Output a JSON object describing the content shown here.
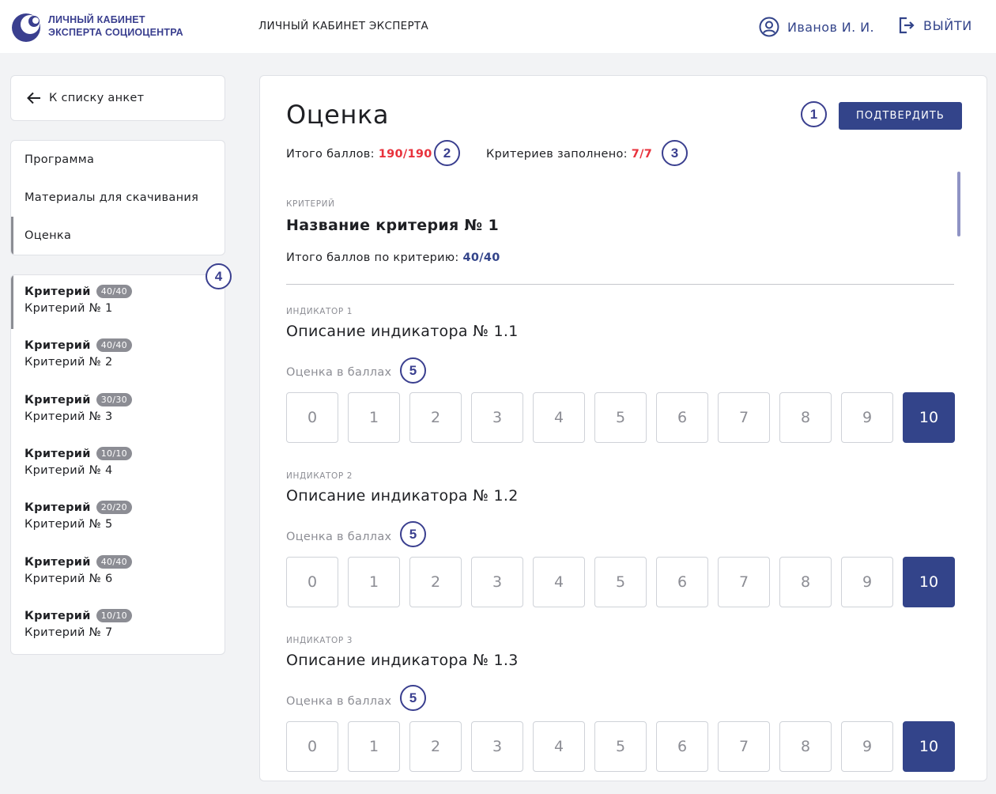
{
  "header": {
    "logo_line1": "ЛИЧНЫЙ КАБИНЕТ",
    "logo_line2": "ЭКСПЕРТА СОЦИОЦЕНТРА",
    "title": "ЛИЧНЫЙ КАБИНЕТ ЭКСПЕРТА",
    "user_name": "Иванов И. И.",
    "logout_label": "ВЫЙТИ"
  },
  "sidebar": {
    "back_label": "К списку анкет",
    "nav": [
      {
        "label": "Программа"
      },
      {
        "label": "Материалы для скачивания"
      },
      {
        "label": "Оценка"
      }
    ],
    "active_nav": "Оценка",
    "criteria": [
      {
        "title": "Критерий",
        "badge": "40/40",
        "name": "Критерий № 1"
      },
      {
        "title": "Критерий",
        "badge": "40/40",
        "name": "Критерий № 2"
      },
      {
        "title": "Критерий",
        "badge": "30/30",
        "name": "Критерий № 3"
      },
      {
        "title": "Критерий",
        "badge": "10/10",
        "name": "Критерий № 4"
      },
      {
        "title": "Критерий",
        "badge": "20/20",
        "name": "Критерий № 5"
      },
      {
        "title": "Критерий",
        "badge": "40/40",
        "name": "Критерий № 6"
      },
      {
        "title": "Критерий",
        "badge": "10/10",
        "name": "Критерий № 7"
      }
    ]
  },
  "main": {
    "title": "Оценка",
    "confirm_label": "ПОДТВЕРДИТЬ",
    "total_label": "Итого баллов:",
    "total_value": "190/190",
    "filled_label": "Критериев заполнено:",
    "filled_value": "7/7",
    "criterion": {
      "caption": "КРИТЕРИЙ",
      "name": "Название критерия № 1",
      "total_label": "Итого баллов по критерию:",
      "total_value": "40/40"
    },
    "indicators": [
      {
        "caption": "ИНДИКАТОР 1",
        "name": "Описание индикатора № 1.1",
        "score_label": "Оценка в баллах",
        "selected": 10
      },
      {
        "caption": "ИНДИКАТОР 2",
        "name": "Описание индикатора № 1.2",
        "score_label": "Оценка в баллах",
        "selected": 10
      },
      {
        "caption": "ИНДИКАТОР 3",
        "name": "Описание индикатора № 1.3",
        "score_label": "Оценка в баллах",
        "selected": 10
      }
    ],
    "score_options": [
      "0",
      "1",
      "2",
      "3",
      "4",
      "5",
      "6",
      "7",
      "8",
      "9",
      "10"
    ]
  },
  "markers": {
    "m1": "1",
    "m2": "2",
    "m3": "3",
    "m4": "4",
    "m5": "5"
  },
  "colors": {
    "accent": "#33448a",
    "brand": "#3a3f8f",
    "alert": "#e8323c",
    "muted": "#8c8d94"
  }
}
